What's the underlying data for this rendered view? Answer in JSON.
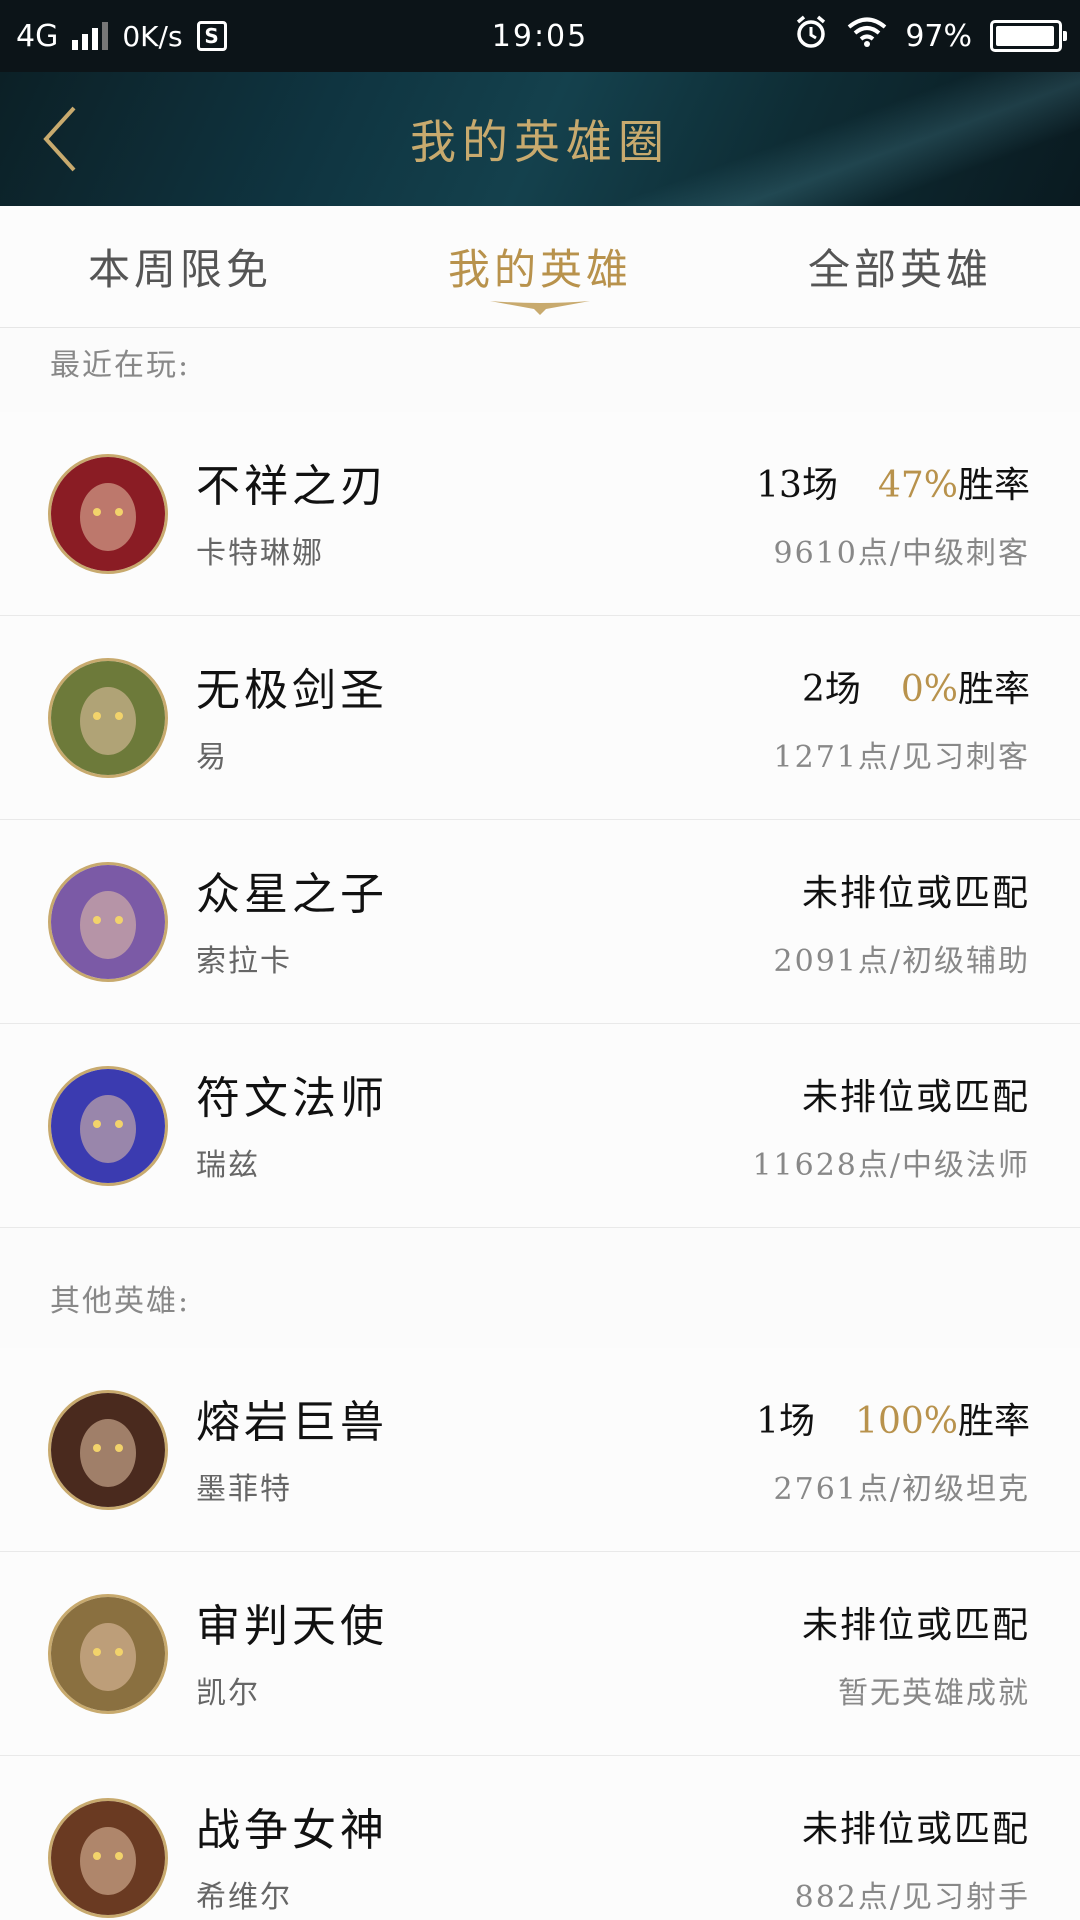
{
  "status_bar": {
    "network": "4G",
    "speed": "0K/s",
    "s_icon": "S",
    "time": "19:05",
    "battery": "97%",
    "battery_level": 0.97
  },
  "header": {
    "title": "我的英雄圈"
  },
  "tabs": [
    {
      "label": "本周限免",
      "active": false
    },
    {
      "label": "我的英雄",
      "active": true
    },
    {
      "label": "全部英雄",
      "active": false
    }
  ],
  "sections": {
    "recent_label": "最近在玩:",
    "other_label": "其他英雄:"
  },
  "recent_heroes": [
    {
      "name": "不祥之刃",
      "champion": "卡特琳娜",
      "games": "13场",
      "rate": "47%",
      "rate_label": "胜率",
      "points": "9610点/中级刺客",
      "avatar_color": "#8a1c24"
    },
    {
      "name": "无极剑圣",
      "champion": "易",
      "games": "2场",
      "rate": "0%",
      "rate_label": "胜率",
      "points": "1271点/见习刺客",
      "avatar_color": "#6d7a3a"
    },
    {
      "name": "众星之子",
      "champion": "索拉卡",
      "unranked": "未排位或匹配",
      "points": "2091点/初级辅助",
      "avatar_color": "#7b5aa6"
    },
    {
      "name": "符文法师",
      "champion": "瑞兹",
      "unranked": "未排位或匹配",
      "points": "11628点/中级法师",
      "avatar_color": "#3b3bb0"
    }
  ],
  "other_heroes": [
    {
      "name": "熔岩巨兽",
      "champion": "墨菲特",
      "games": "1场",
      "rate": "100%",
      "rate_label": "胜率",
      "points": "2761点/初级坦克",
      "avatar_color": "#4a2a1e"
    },
    {
      "name": "审判天使",
      "champion": "凯尔",
      "unranked": "未排位或匹配",
      "points": "暂无英雄成就",
      "avatar_color": "#8a7040"
    },
    {
      "name": "战争女神",
      "champion": "希维尔",
      "unranked": "未排位或匹配",
      "points": "882点/见习射手",
      "avatar_color": "#6a3a22"
    }
  ],
  "colors": {
    "accent_gold": "#c8aa6e",
    "header_bg": "#0f3440",
    "status_bg": "#0c1418"
  }
}
